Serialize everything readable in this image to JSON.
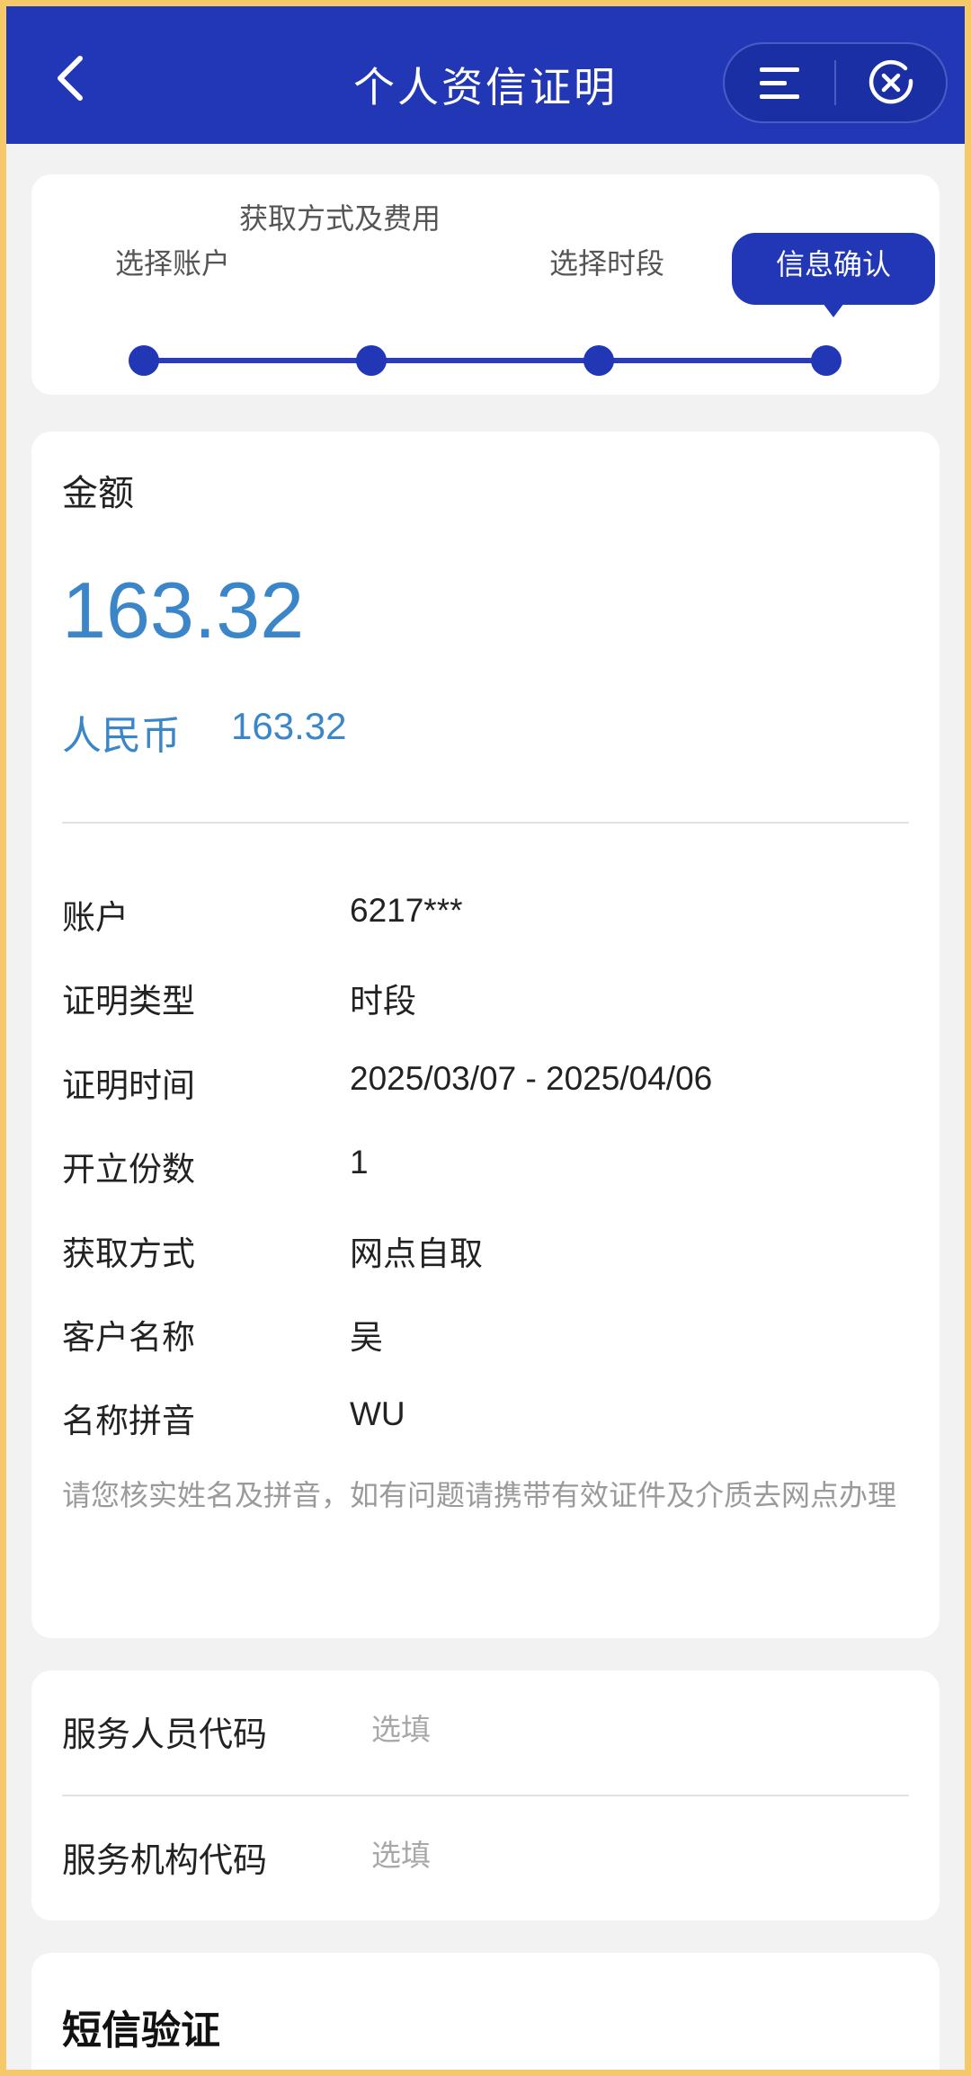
{
  "header": {
    "title": "个人资信证明"
  },
  "steps": [
    {
      "label": "选择账户"
    },
    {
      "label": "获取方式及费用"
    },
    {
      "label": "选择时段"
    },
    {
      "label": "信息确认",
      "active": true
    }
  ],
  "amount": {
    "label": "金额",
    "value": "163.32",
    "currency_label": "人民币",
    "currency_value": "163.32"
  },
  "details": [
    {
      "label": "账户",
      "value": "6217***"
    },
    {
      "label": "证明类型",
      "value": "时段"
    },
    {
      "label": "证明时间",
      "value": "2025/03/07 - 2025/04/06"
    },
    {
      "label": "开立份数",
      "value": "1"
    },
    {
      "label": "获取方式",
      "value": "网点自取"
    },
    {
      "label": "客户名称",
      "value": "吴"
    },
    {
      "label": "名称拼音",
      "value": "WU"
    }
  ],
  "notice": "请您核实姓名及拼音，如有问题请携带有效证件及介质去网点办理",
  "service": {
    "staff_code_label": "服务人员代码",
    "staff_code_placeholder": "选填",
    "org_code_label": "服务机构代码",
    "org_code_placeholder": "选填"
  },
  "sms": {
    "title": "短信验证"
  },
  "colors": {
    "primary": "#2137b6",
    "amount": "#3a86c8",
    "frame": "#f5c869"
  }
}
